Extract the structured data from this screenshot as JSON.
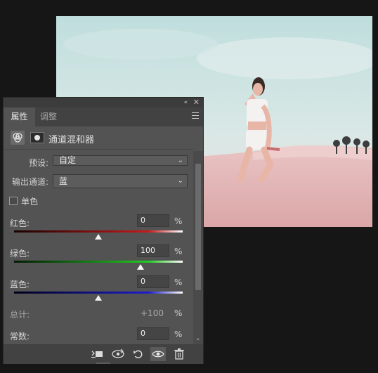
{
  "panel": {
    "tabs": [
      {
        "label": "属性"
      },
      {
        "label": "调整"
      }
    ],
    "adjustment_title": "通道混和器",
    "preset": {
      "label": "预设:",
      "value": "自定"
    },
    "output_channel": {
      "label": "输出通道:",
      "value": "蓝"
    },
    "monochrome": {
      "label": "单色",
      "checked": false
    },
    "channels": [
      {
        "label": "红色:",
        "value": "0",
        "unit": "%",
        "level_percent": 0,
        "color": "#ff2a2a"
      },
      {
        "label": "绿色:",
        "value": "100",
        "unit": "%",
        "level_percent": 100,
        "color": "#28e028"
      },
      {
        "label": "蓝色:",
        "value": "0",
        "unit": "%",
        "level_percent": 0,
        "color": "#2a2aff"
      }
    ],
    "total": {
      "label": "总计:",
      "value": "+100",
      "unit": "%"
    },
    "constant": {
      "label": "常数:",
      "value": "0",
      "unit": "%"
    },
    "icons": {
      "collapse": "«",
      "close": "✕",
      "menu": "panel-menu-icon",
      "adjustment": "channel-mixer-icon",
      "mask": "layer-mask-icon",
      "clip": "clip-to-layer-icon",
      "view_previous": "view-previous-state-icon",
      "reset": "reset-icon",
      "visibility": "eye-icon",
      "delete": "trash-icon"
    }
  }
}
